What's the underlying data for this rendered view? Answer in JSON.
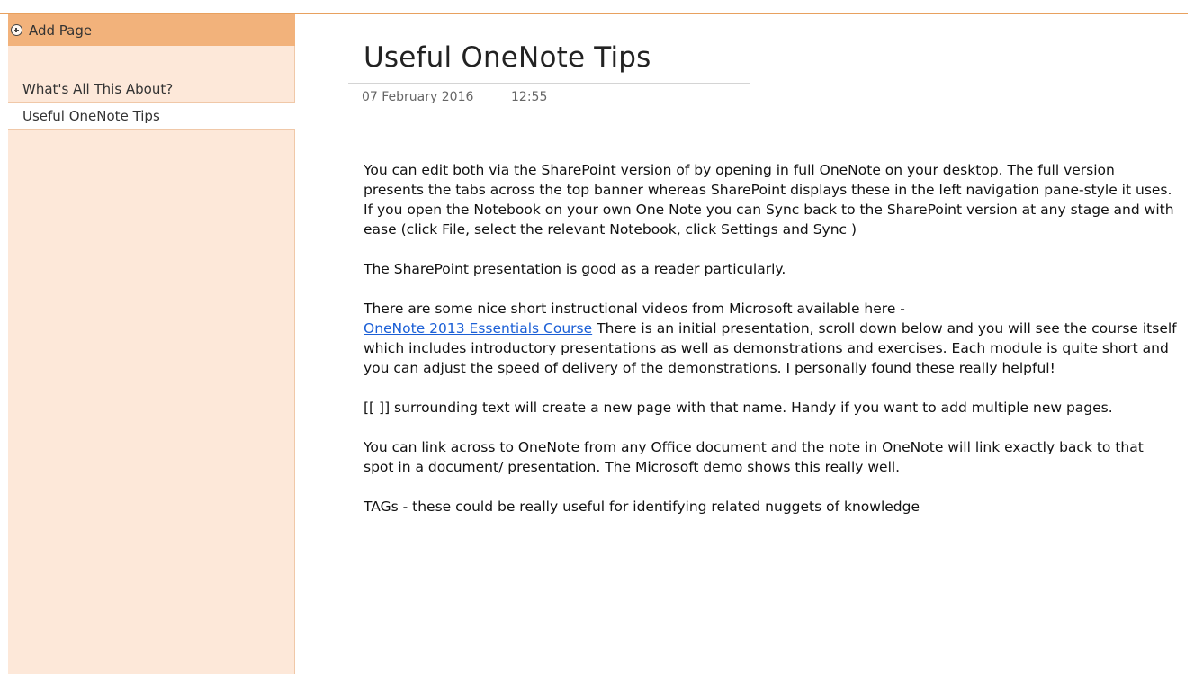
{
  "sidebar": {
    "add_page_label": "Add Page",
    "pages": [
      {
        "label": "What's All This About?"
      },
      {
        "label": "Useful OneNote Tips",
        "selected": true
      }
    ]
  },
  "page": {
    "title": "Useful OneNote Tips",
    "date": "07 February 2016",
    "time": "12:55",
    "paragraphs": [
      "You can edit both via the SharePoint version of by opening in full OneNote on your desktop.  The full version presents the tabs across the top banner whereas SharePoint displays these in the left navigation pane-style it uses.   If you open the Notebook on your own One Note you can Sync back to the SharePoint version at any stage and with ease (click File, select the relevant Notebook, click Settings and Sync )",
      "The SharePoint presentation is good as a reader particularly.",
      "[[ ]] surrounding text will create a new page with that name.  Handy if you want to add multiple new pages.",
      "You can link across to OneNote from any Office document and the note in OneNote will link exactly back to that spot in a document/ presentation.  The Microsoft demo shows this really well.",
      "TAGs - these could be really useful for identifying related nuggets of knowledge"
    ],
    "videos": {
      "intro": "There are some nice short instructional videos from Microsoft available here -",
      "link_text": "OneNote 2013 Essentials Course",
      "after": "  There is an initial presentation, scroll down below and you will see the course itself which includes introductory presentations as well as demonstrations and exercises.  Each module is quite short and you can adjust the speed of delivery of the demonstrations.  I personally found these really helpful!"
    }
  },
  "colors": {
    "accent": "#f2b27b",
    "sidebar_bg": "#fde8d9",
    "link": "#1b5fd6"
  }
}
